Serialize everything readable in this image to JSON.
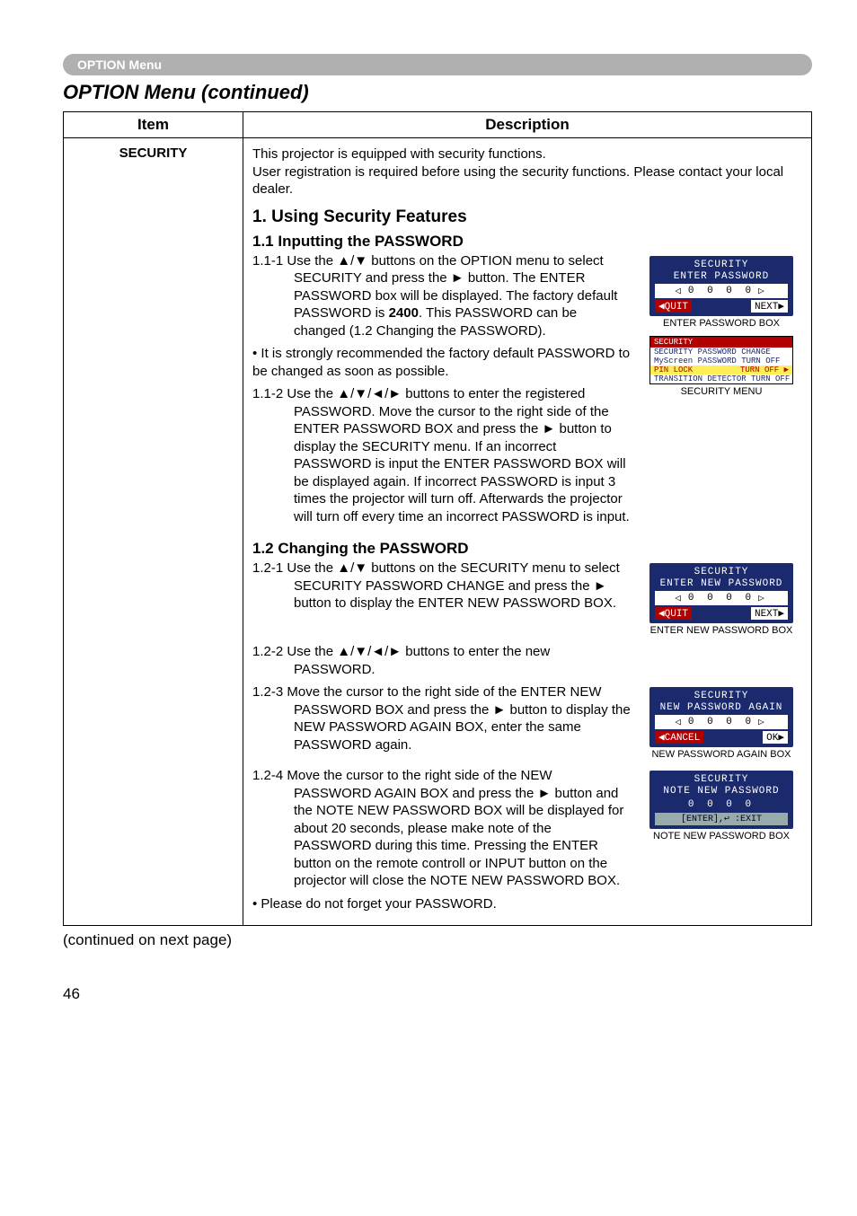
{
  "header": {
    "menu_label": "OPTION Menu"
  },
  "page": {
    "title": "OPTION Menu (continued)",
    "continued": "(continued on next page)",
    "page_number": "46"
  },
  "table": {
    "headers": {
      "item": "Item",
      "description": "Description"
    },
    "item_label": "SECURITY",
    "intro": "This projector is equipped with security functions.\nUser registration is required before using the security functions. Please contact your local dealer.",
    "sec1_title": "1. Using Security Features",
    "sec11_title": "1.1 Inputting the PASSWORD",
    "p_1_1_1a": "1.1-1 Use the ▲/▼ buttons on the OPTION menu to select SECURITY and press the ► button. The ENTER PASSWORD box will be displayed. The factory default PASSWORD is ",
    "p_1_1_1b": "2400",
    "p_1_1_1c": ". This PASSWORD can be changed (1.2 Changing the PASSWORD).",
    "p_1_1_note": "• It is strongly recommended the factory default PASSWORD to be changed as soon as possible.",
    "p_1_1_2": "1.1-2 Use the ▲/▼/◄/► buttons to enter the registered PASSWORD. Move the cursor to the right side of the ENTER PASSWORD BOX and press the ► button to display the SECURITY menu. If an incorrect PASSWORD is input the ENTER PASSWORD BOX will be displayed again. If incorrect PASSWORD is input 3 times the projector will turn off. Afterwards the projector will turn off every time an incorrect PASSWORD is input.",
    "sec12_title": "1.2 Changing the PASSWORD",
    "p_1_2_1": "1.2-1 Use the ▲/▼ buttons on the SECURITY menu to select SECURITY PASSWORD CHANGE and press the ► button to display the ENTER NEW PASSWORD BOX.",
    "p_1_2_2": "1.2-2 Use the ▲/▼/◄/► buttons to enter the new PASSWORD.",
    "p_1_2_3": "1.2-3 Move the cursor to the right side of the ENTER NEW PASSWORD BOX and press the ► button to display the NEW PASSWORD AGAIN BOX, enter the same PASSWORD again.",
    "p_1_2_4": "1.2-4 Move the cursor to the right side of the NEW PASSWORD AGAIN BOX and press the ► button and the NOTE NEW PASSWORD BOX will be displayed for about 20 seconds, please make note of the PASSWORD during this time. Pressing the ENTER button on the remote controll or INPUT button on the projector will close the NOTE NEW PASSWORD BOX.",
    "p_1_2_note": "• Please do not forget your PASSWORD."
  },
  "osd": {
    "enter_pw": {
      "t1": "SECURITY",
      "t2": "ENTER PASSWORD",
      "digits": "0  0  0  0",
      "left": "◀QUIT",
      "right": "NEXT▶",
      "caption": "ENTER PASSWORD BOX"
    },
    "sec_menu": {
      "title": "SECURITY",
      "r1": "SECURITY PASSWORD CHANGE",
      "r2": "MyScreen PASSWORD TURN OFF",
      "r3a": "PIN LOCK",
      "r3b": "TURN OFF ▶",
      "r4": "TRANSITION DETECTOR TURN OFF",
      "caption": "SECURITY MENU"
    },
    "enter_new": {
      "t1": "SECURITY",
      "t2": "ENTER NEW PASSWORD",
      "digits": "0  0  0  0",
      "left": "◀QUIT",
      "right": "NEXT▶",
      "caption": "ENTER NEW PASSWORD BOX"
    },
    "again": {
      "t1": "SECURITY",
      "t2": "NEW PASSWORD AGAIN",
      "digits": "0  0  0  0",
      "left": "◀CANCEL",
      "right": "OK▶",
      "caption": "NEW PASSWORD AGAIN BOX"
    },
    "note": {
      "t1": "SECURITY",
      "t2": "NOTE NEW PASSWORD",
      "digits": "0  0  0  0",
      "bottom": "[ENTER],↩ :EXIT",
      "caption": "NOTE NEW PASSWORD BOX"
    }
  }
}
